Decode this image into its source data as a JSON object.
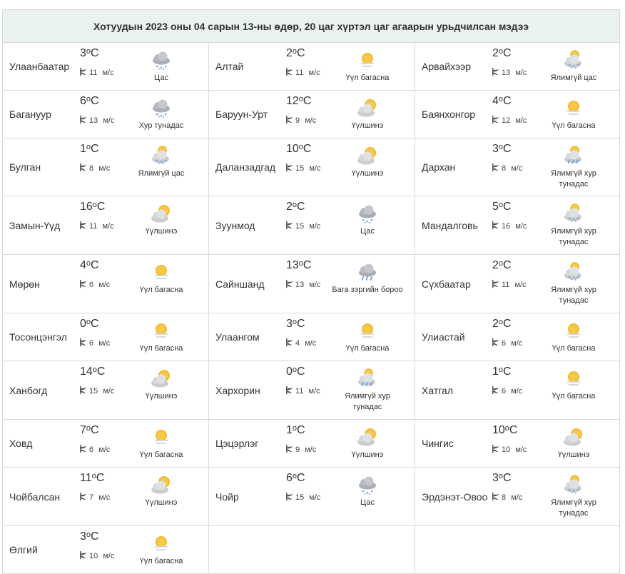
{
  "title": "Хотуудын 2023 оны 04 сарын 13-ны өдөр, 20 цаг хүртэл цаг агаарын урьдчилсан мэдээ",
  "unit_wind": "м/с",
  "rows": [
    {
      "h": 66,
      "cells": [
        {
          "city": "Улаанбаатар",
          "temp": "3",
          "wind": "11",
          "icon": "cloud-snow-icon",
          "desc": "Цас"
        },
        {
          "city": "Алтай",
          "temp": "2",
          "wind": "11",
          "icon": "sun-haze-icon",
          "desc": "Үүл багасна"
        },
        {
          "city": "Арвайхээр",
          "temp": "2",
          "wind": "13",
          "icon": "partly-cloudy-icon",
          "desc": "Ялимгүй цас"
        }
      ]
    },
    {
      "h": 66,
      "cells": [
        {
          "city": "Багануур",
          "temp": "6",
          "wind": "13",
          "icon": "cloud-snow-icon",
          "desc": "Хур тунадас"
        },
        {
          "city": "Баруун-Урт",
          "temp": "12",
          "wind": "9",
          "icon": "sun-cloud-icon",
          "desc": "Үүлшинэ"
        },
        {
          "city": "Баянхонгор",
          "temp": "4",
          "wind": "12",
          "icon": "sun-haze-icon",
          "desc": "Үүл багасна"
        }
      ]
    },
    {
      "h": 80,
      "cells": [
        {
          "city": "Булган",
          "temp": "1",
          "wind": "8",
          "icon": "partly-cloudy-icon",
          "desc": "Ялимгүй цас"
        },
        {
          "city": "Даланзадгад",
          "temp": "10",
          "wind": "15",
          "icon": "sun-cloud-icon",
          "desc": "Үүлшинэ"
        },
        {
          "city": "Дархан",
          "temp": "3",
          "wind": "8",
          "icon": "partly-cloudy-rain-icon",
          "desc": "Ялимгүй хур тунадас"
        }
      ]
    },
    {
      "h": 81,
      "cells": [
        {
          "city": "Замын-Үүд",
          "temp": "16",
          "wind": "11",
          "icon": "sun-cloud-icon",
          "desc": "Үүлшинэ"
        },
        {
          "city": "Зуунмод",
          "temp": "2",
          "wind": "15",
          "icon": "cloud-snow-icon",
          "desc": "Цас"
        },
        {
          "city": "Мандалговь",
          "temp": "5",
          "wind": "16",
          "icon": "partly-cloudy-icon",
          "desc": "Ялимгүй хур тунадас"
        }
      ]
    },
    {
      "h": 81,
      "cells": [
        {
          "city": "Мөрөн",
          "temp": "4",
          "wind": "6",
          "icon": "sun-haze-icon",
          "desc": "Үүл багасна"
        },
        {
          "city": "Сайншанд",
          "temp": "13",
          "wind": "13",
          "icon": "cloud-rain-icon",
          "desc": "Бага зэргийн бороо"
        },
        {
          "city": "Сүхбаатар",
          "temp": "2",
          "wind": "11",
          "icon": "partly-cloudy-icon",
          "desc": "Ялимгүй хур тунадас"
        }
      ]
    },
    {
      "h": 66,
      "cells": [
        {
          "city": "Тосонцэнгэл",
          "temp": "0",
          "wind": "6",
          "icon": "sun-haze-icon",
          "desc": "Үүл багасна"
        },
        {
          "city": "Улаангом",
          "temp": "3",
          "wind": "4",
          "icon": "sun-haze-icon",
          "desc": "Үүл багасна"
        },
        {
          "city": "Улиастай",
          "temp": "2",
          "wind": "6",
          "icon": "sun-haze-icon",
          "desc": "Үүл багасна"
        }
      ]
    },
    {
      "h": 81,
      "cells": [
        {
          "city": "Ханбогд",
          "temp": "14",
          "wind": "15",
          "icon": "sun-cloud-icon",
          "desc": "Үүлшинэ"
        },
        {
          "city": "Хархорин",
          "temp": "0",
          "wind": "11",
          "icon": "partly-cloudy-rain-icon",
          "desc": "Ялимгүй хур тунадас"
        },
        {
          "city": "Хатгал",
          "temp": "1",
          "wind": "6",
          "icon": "sun-haze-icon",
          "desc": "Үүл багасна"
        }
      ]
    },
    {
      "h": 66,
      "cells": [
        {
          "city": "Ховд",
          "temp": "7",
          "wind": "6",
          "icon": "sun-haze-icon",
          "desc": "Үүл багасна"
        },
        {
          "city": "Цэцэрлэг",
          "temp": "1",
          "wind": "9",
          "icon": "sun-cloud-icon",
          "desc": "Үүлшинэ"
        },
        {
          "city": "Чингис",
          "temp": "10",
          "wind": "10",
          "icon": "sun-cloud-icon",
          "desc": "Үүлшинэ"
        }
      ]
    },
    {
      "h": 81,
      "cells": [
        {
          "city": "Чойбалсан",
          "temp": "11",
          "wind": "7",
          "icon": "sun-cloud-icon",
          "desc": "Үүлшинэ"
        },
        {
          "city": "Чойр",
          "temp": "6",
          "wind": "15",
          "icon": "cloud-snow-icon",
          "desc": "Цас"
        },
        {
          "city": "Эрдэнэт-Овоо",
          "temp": "3",
          "wind": "8",
          "icon": "partly-cloudy-icon",
          "desc": "Ялимгүй хур тунадас"
        }
      ]
    },
    {
      "h": 66,
      "cells": [
        {
          "city": "Өлгий",
          "temp": "3",
          "wind": "10",
          "icon": "sun-haze-icon",
          "desc": "Үүл багасна"
        },
        null,
        null
      ]
    }
  ]
}
